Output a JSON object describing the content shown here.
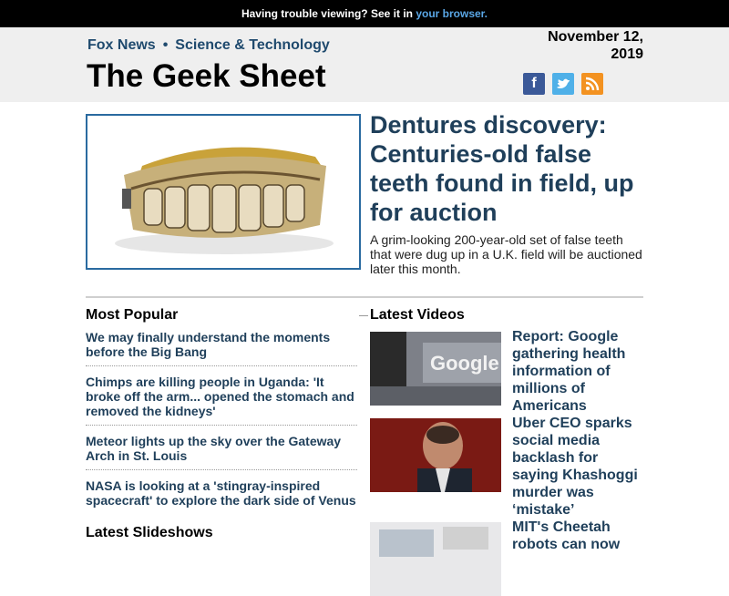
{
  "topbar": {
    "text": "Having trouble viewing? See it in",
    "link": "your browser."
  },
  "header": {
    "brand": "Fox News",
    "section": "Science & Technology",
    "title": "The Geek Sheet",
    "date_line1": "November 12,",
    "date_line2": "2019",
    "social": [
      "facebook-icon",
      "twitter-icon",
      "rss-icon"
    ]
  },
  "hero": {
    "title": "Dentures discovery: Centuries-old false teeth found in field, up for auction",
    "description": "A grim-looking 200-year-old set of false teeth that were dug up in a U.K. field will be auctioned later this month."
  },
  "most_popular": {
    "title": "Most Popular",
    "items": [
      "We may finally understand the moments before the Big Bang",
      "Chimps are killing people in Uganda: 'It broke off the arm... opened the stomach and removed the kidneys'",
      "Meteor lights up the sky over the Gateway Arch in St. Louis",
      "NASA is looking at a 'stingray-inspired spacecraft' to explore the dark side of Venus"
    ]
  },
  "latest_slideshows": {
    "title": "Latest Slideshows"
  },
  "latest_videos": {
    "title": "Latest Videos",
    "items": [
      "Report: Google gathering health information of millions of Americans",
      "Uber CEO sparks social media backlash for saying Khashoggi murder was ‘mistake’",
      "MIT's Cheetah robots can now"
    ]
  },
  "colors": {
    "accent": "#1f3f5a",
    "link_blue": "#5aa7e6",
    "header_bg": "#efefef",
    "image_border": "#2a6aa0"
  }
}
